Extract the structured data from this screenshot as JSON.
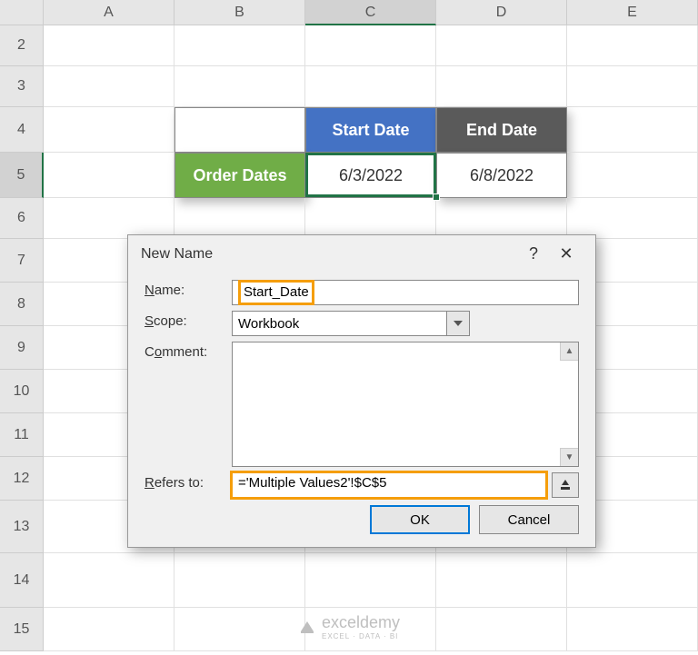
{
  "columns": [
    "A",
    "B",
    "C",
    "D",
    "E"
  ],
  "rows": [
    "2",
    "3",
    "4",
    "5",
    "6",
    "7",
    "8",
    "9",
    "10",
    "11",
    "12",
    "13",
    "14",
    "15"
  ],
  "selected_col": "C",
  "selected_row": "5",
  "table": {
    "header_start": "Start Date",
    "header_end": "End Date",
    "label_order": "Order Dates",
    "start_value": "6/3/2022",
    "end_value": "6/8/2022"
  },
  "dialog": {
    "title": "New Name",
    "help": "?",
    "close": "✕",
    "name_label": "Name:",
    "name_value": "Start_Date",
    "scope_label": "Scope:",
    "scope_value": "Workbook",
    "comment_label": "Comment:",
    "refers_label": "Refers to:",
    "refers_value": "='Multiple Values2'!$C$5",
    "ok": "OK",
    "cancel": "Cancel"
  },
  "watermark": {
    "brand": "exceldemy",
    "tagline": "EXCEL · DATA · BI"
  }
}
